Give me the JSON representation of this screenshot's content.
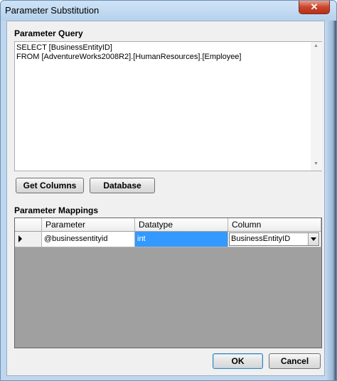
{
  "window": {
    "title": "Parameter Substitution",
    "close_label": "✕"
  },
  "query": {
    "label": "Parameter Query",
    "text": "SELECT [BusinessEntityID]\nFROM [AdventureWorks2008R2].[HumanResources].[Employee]"
  },
  "buttons": {
    "get_columns": "Get Columns",
    "database": "Database",
    "ok": "OK",
    "cancel": "Cancel"
  },
  "mappings": {
    "label": "Parameter Mappings",
    "columns": [
      "Parameter",
      "Datatype",
      "Column"
    ],
    "rows": [
      {
        "parameter": "@businessentityid",
        "datatype": "int",
        "column": "BusinessEntityID"
      }
    ]
  }
}
